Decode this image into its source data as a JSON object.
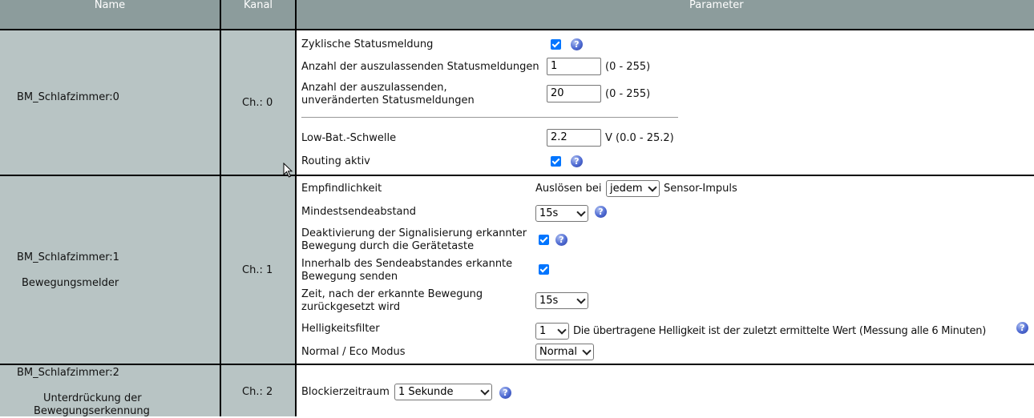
{
  "header": {
    "name": "Name",
    "kanal": "Kanal",
    "parameter": "Parameter"
  },
  "rows": [
    {
      "name": "BM_Schlafzimmer:0",
      "channel": "Ch.: 0",
      "params": {
        "cyclic_status": "Zyklische Statusmeldung",
        "skip_count_label": "Anzahl der auszulassenden Statusmeldungen",
        "skip_count_value": "1",
        "skip_count_range": "(0 - 255)",
        "skip_unchanged_label_1": "Anzahl der auszulassenden,",
        "skip_unchanged_label_2": "unveränderten Statusmeldungen",
        "skip_unchanged_value": "20",
        "skip_unchanged_range": "(0 - 255)",
        "lowbat_label": "Low-Bat.-Schwelle",
        "lowbat_value": "2.2",
        "lowbat_range": "V (0.0 - 25.2)",
        "routing_label": "Routing aktiv"
      }
    },
    {
      "name": "BM_Schlafzimmer:1",
      "subname": "Bewegungsmelder",
      "channel": "Ch.: 1",
      "params": {
        "sensitivity_label": "Empfindlichkeit",
        "sensitivity_prefix": "Auslösen bei",
        "sensitivity_value": "jedem",
        "sensitivity_suffix": "Sensor-Impuls",
        "min_send_label": "Mindestsendeabstand",
        "min_send_value": "15s",
        "deact_label_1": "Deaktivierung der Signalisierung erkannter",
        "deact_label_2": "Bewegung durch die Gerätetaste",
        "within_label_1": "Innerhalb des Sendeabstandes erkannte",
        "within_label_2": "Bewegung senden",
        "reset_label_1": "Zeit, nach der erkannte Bewegung",
        "reset_label_2": "zurückgesetzt wird",
        "reset_value": "15s",
        "brightness_label": "Helligkeitsfilter",
        "brightness_value": "1",
        "brightness_desc": "Die übertragene Helligkeit ist der zuletzt ermittelte Wert (Messung alle 6 Minuten)",
        "eco_label": "Normal / Eco Modus",
        "eco_value": "Normal"
      }
    },
    {
      "name": "BM_Schlafzimmer:2",
      "subname_1": "Unterdrückung der",
      "subname_2": "Bewegungserkennung",
      "channel": "Ch.: 2",
      "params": {
        "block_label": "Blockierzeitraum",
        "block_value": "1 Sekunde"
      }
    }
  ],
  "icons": {
    "help": "help-icon",
    "checkbox": "checkbox-checked-icon",
    "cursor": "mouse-pointer-icon"
  },
  "colors": {
    "header_bg": "#8c9c9c",
    "cell_bg": "#b8c4c4",
    "checkbox": "#0075ff",
    "help": "#4f6bd3"
  }
}
